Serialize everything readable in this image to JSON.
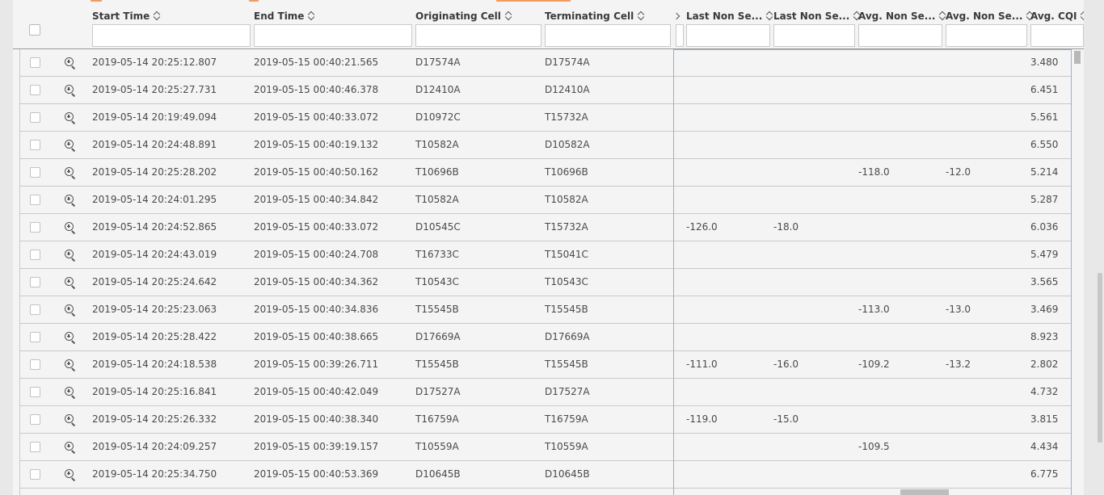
{
  "columns": [
    {
      "key": "start",
      "label": "Start Time"
    },
    {
      "key": "end",
      "label": "End Time"
    },
    {
      "key": "orig",
      "label": "Originating Cell"
    },
    {
      "key": "term",
      "label": "Terminating Cell"
    },
    {
      "key": "lns1",
      "label": "Last Non Se..."
    },
    {
      "key": "lns2",
      "label": "Last Non Se..."
    },
    {
      "key": "ans1",
      "label": "Avg. Non Se..."
    },
    {
      "key": "ans2",
      "label": "Avg. Non Se..."
    },
    {
      "key": "cqi",
      "label": "Avg. CQI"
    }
  ],
  "rows": [
    {
      "start": "2019-05-14 20:25:12.807",
      "end": "2019-05-15 00:40:21.565",
      "orig": "D17574A",
      "term": "D17574A",
      "lns1": "",
      "lns2": "",
      "ans1": "",
      "ans2": "",
      "cqi": "3.480"
    },
    {
      "start": "2019-05-14 20:25:27.731",
      "end": "2019-05-15 00:40:46.378",
      "orig": "D12410A",
      "term": "D12410A",
      "lns1": "",
      "lns2": "",
      "ans1": "",
      "ans2": "",
      "cqi": "6.451"
    },
    {
      "start": "2019-05-14 20:19:49.094",
      "end": "2019-05-15 00:40:33.072",
      "orig": "D10972C",
      "term": "T15732A",
      "lns1": "",
      "lns2": "",
      "ans1": "",
      "ans2": "",
      "cqi": "5.561"
    },
    {
      "start": "2019-05-14 20:24:48.891",
      "end": "2019-05-15 00:40:19.132",
      "orig": "T10582A",
      "term": "D10582A",
      "lns1": "",
      "lns2": "",
      "ans1": "",
      "ans2": "",
      "cqi": "6.550"
    },
    {
      "start": "2019-05-14 20:25:28.202",
      "end": "2019-05-15 00:40:50.162",
      "orig": "T10696B",
      "term": "T10696B",
      "lns1": "",
      "lns2": "",
      "ans1": "-118.0",
      "ans2": "-12.0",
      "cqi": "5.214"
    },
    {
      "start": "2019-05-14 20:24:01.295",
      "end": "2019-05-15 00:40:34.842",
      "orig": "T10582A",
      "term": "T10582A",
      "lns1": "",
      "lns2": "",
      "ans1": "",
      "ans2": "",
      "cqi": "5.287"
    },
    {
      "start": "2019-05-14 20:24:52.865",
      "end": "2019-05-15 00:40:33.072",
      "orig": "D10545C",
      "term": "T15732A",
      "lns1": "-126.0",
      "lns2": "-18.0",
      "ans1": "",
      "ans2": "",
      "cqi": "6.036"
    },
    {
      "start": "2019-05-14 20:24:43.019",
      "end": "2019-05-15 00:40:24.708",
      "orig": "T16733C",
      "term": "T15041C",
      "lns1": "",
      "lns2": "",
      "ans1": "",
      "ans2": "",
      "cqi": "5.479"
    },
    {
      "start": "2019-05-14 20:25:24.642",
      "end": "2019-05-15 00:40:34.362",
      "orig": "T10543C",
      "term": "T10543C",
      "lns1": "",
      "lns2": "",
      "ans1": "",
      "ans2": "",
      "cqi": "3.565"
    },
    {
      "start": "2019-05-14 20:25:23.063",
      "end": "2019-05-15 00:40:34.836",
      "orig": "T15545B",
      "term": "T15545B",
      "lns1": "",
      "lns2": "",
      "ans1": "-113.0",
      "ans2": "-13.0",
      "cqi": "3.469"
    },
    {
      "start": "2019-05-14 20:25:28.422",
      "end": "2019-05-15 00:40:38.665",
      "orig": "D17669A",
      "term": "D17669A",
      "lns1": "",
      "lns2": "",
      "ans1": "",
      "ans2": "",
      "cqi": "8.923"
    },
    {
      "start": "2019-05-14 20:24:18.538",
      "end": "2019-05-15 00:39:26.711",
      "orig": "T15545B",
      "term": "T15545B",
      "lns1": "-111.0",
      "lns2": "-16.0",
      "ans1": "-109.2",
      "ans2": "-13.2",
      "cqi": "2.802"
    },
    {
      "start": "2019-05-14 20:25:16.841",
      "end": "2019-05-15 00:40:42.049",
      "orig": "D17527A",
      "term": "D17527A",
      "lns1": "",
      "lns2": "",
      "ans1": "",
      "ans2": "",
      "cqi": "4.732"
    },
    {
      "start": "2019-05-14 20:25:26.332",
      "end": "2019-05-15 00:40:38.340",
      "orig": "T16759A",
      "term": "T16759A",
      "lns1": "-119.0",
      "lns2": "-15.0",
      "ans1": "",
      "ans2": "",
      "cqi": "3.815"
    },
    {
      "start": "2019-05-14 20:24:09.257",
      "end": "2019-05-15 00:39:19.157",
      "orig": "T10559A",
      "term": "T10559A",
      "lns1": "",
      "lns2": "",
      "ans1": "-109.5",
      "ans2": "",
      "cqi": "4.434"
    },
    {
      "start": "2019-05-14 20:25:34.750",
      "end": "2019-05-15 00:40:53.369",
      "orig": "D10645B",
      "term": "D10645B",
      "lns1": "",
      "lns2": "",
      "ans1": "",
      "ans2": "",
      "cqi": "6.775"
    }
  ],
  "icons": {
    "row_action": "zoom-in-icon",
    "sort": "sort-icon",
    "column_scroll": "chevron-left-icon"
  },
  "colors": {
    "accent_orange": "#f29b5e",
    "selection_border": "#8fb3d9",
    "background": "#f4f4f4"
  }
}
